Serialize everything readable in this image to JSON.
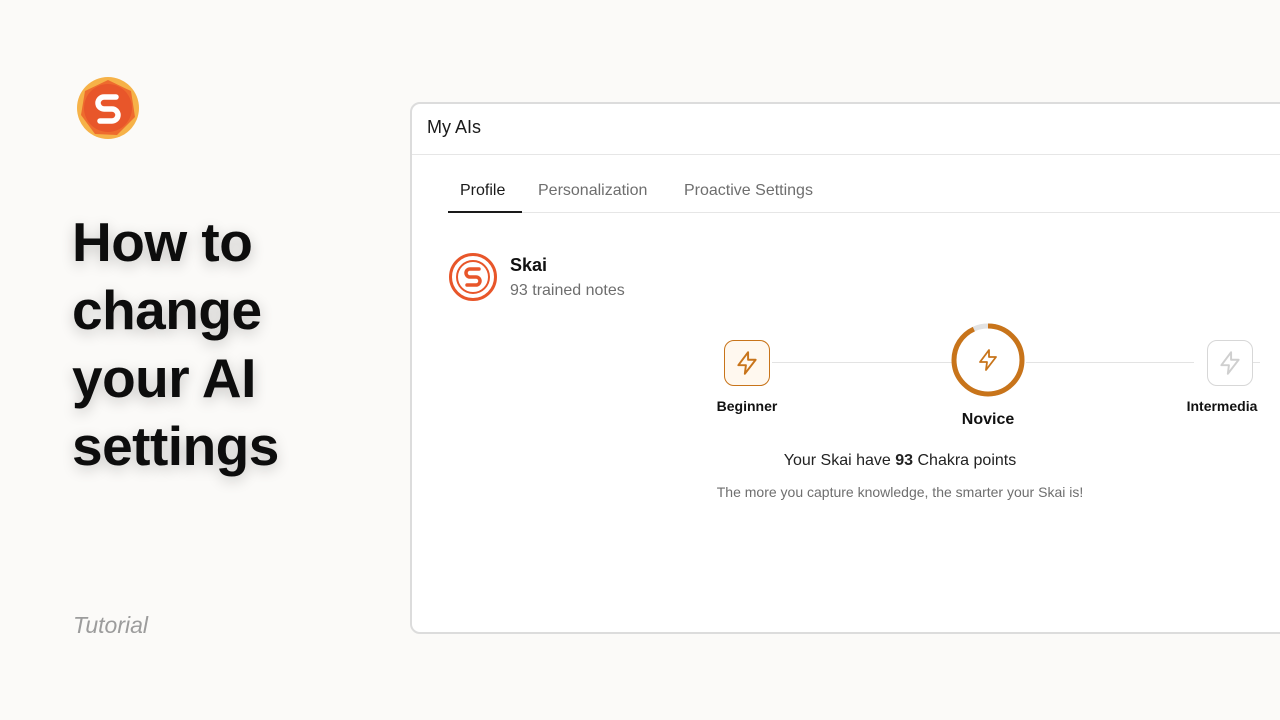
{
  "slide": {
    "headline_lines": [
      "How to",
      "change",
      "your AI",
      "settings"
    ],
    "tag": "Tutorial"
  },
  "window": {
    "title": "My AIs"
  },
  "tabs": [
    {
      "label": "Profile",
      "active": true
    },
    {
      "label": "Personalization",
      "active": false
    },
    {
      "label": "Proactive Settings",
      "active": false
    }
  ],
  "profile": {
    "name": "Skai",
    "notes": "93 trained notes"
  },
  "levels": [
    {
      "label": "Beginner",
      "state": "completed",
      "icon": "lightning-icon"
    },
    {
      "label": "Novice",
      "state": "current",
      "icon": "lightning-icon",
      "progress": 0.93
    },
    {
      "label": "Intermedia",
      "state": "locked",
      "icon": "lightning-icon"
    }
  ],
  "points": {
    "prefix": "Your Skai have ",
    "value": "93",
    "suffix": " Chakra points",
    "subtitle": "The more you capture knowledge, the smarter your Skai is!"
  },
  "colors": {
    "brand_orange": "#e8562a",
    "level_accent": "#c8741a",
    "locked": "#d7d7d7"
  }
}
